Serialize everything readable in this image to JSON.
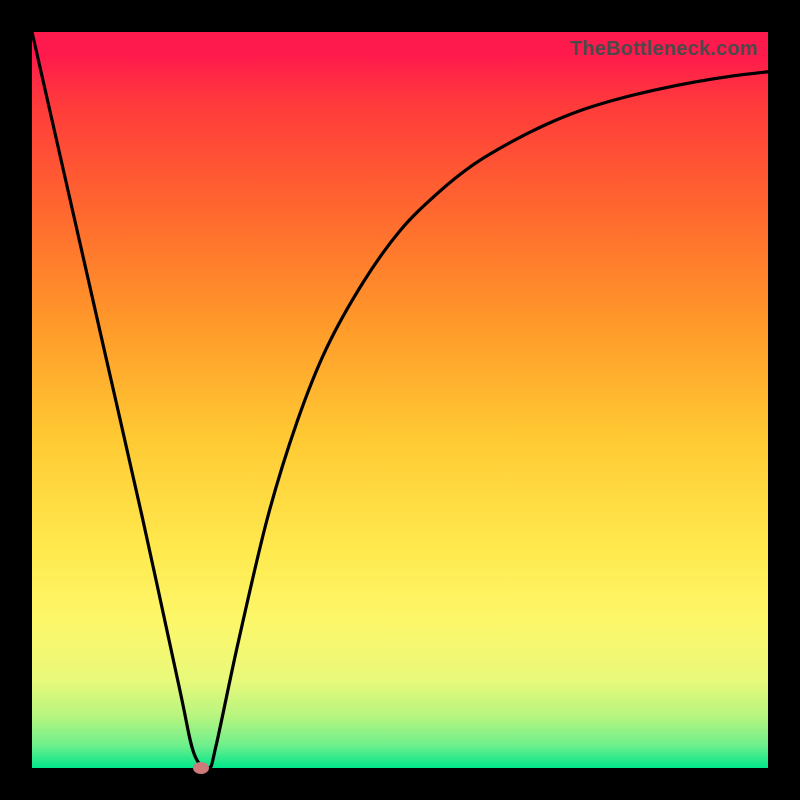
{
  "attribution": "TheBottleneck.com",
  "colors": {
    "frame_background_top": "#ff1a4d",
    "frame_background_bottom": "#00e68a",
    "page_background": "#000000",
    "curve": "#000000",
    "marker": "#cc7a7a",
    "attribution_text": "#4a4a4a"
  },
  "chart_data": {
    "type": "line",
    "title": "",
    "xlabel": "",
    "ylabel": "",
    "xlim": [
      0,
      100
    ],
    "ylim": [
      0,
      100
    ],
    "series": [
      {
        "name": "bottleneck-curve",
        "x": [
          0,
          5,
          10,
          15,
          20,
          22,
          24,
          25,
          28,
          32,
          36,
          40,
          45,
          50,
          55,
          60,
          65,
          70,
          75,
          80,
          85,
          90,
          95,
          100
        ],
        "y": [
          100,
          78,
          56,
          34,
          11,
          2,
          0,
          3,
          17,
          34,
          47,
          57,
          66,
          73,
          78,
          82,
          85,
          87.5,
          89.5,
          91,
          92.2,
          93.2,
          94,
          94.6
        ]
      }
    ],
    "marker": {
      "x": 23,
      "y": 0,
      "label": "optimal-point"
    },
    "grid": false,
    "legend": false
  }
}
